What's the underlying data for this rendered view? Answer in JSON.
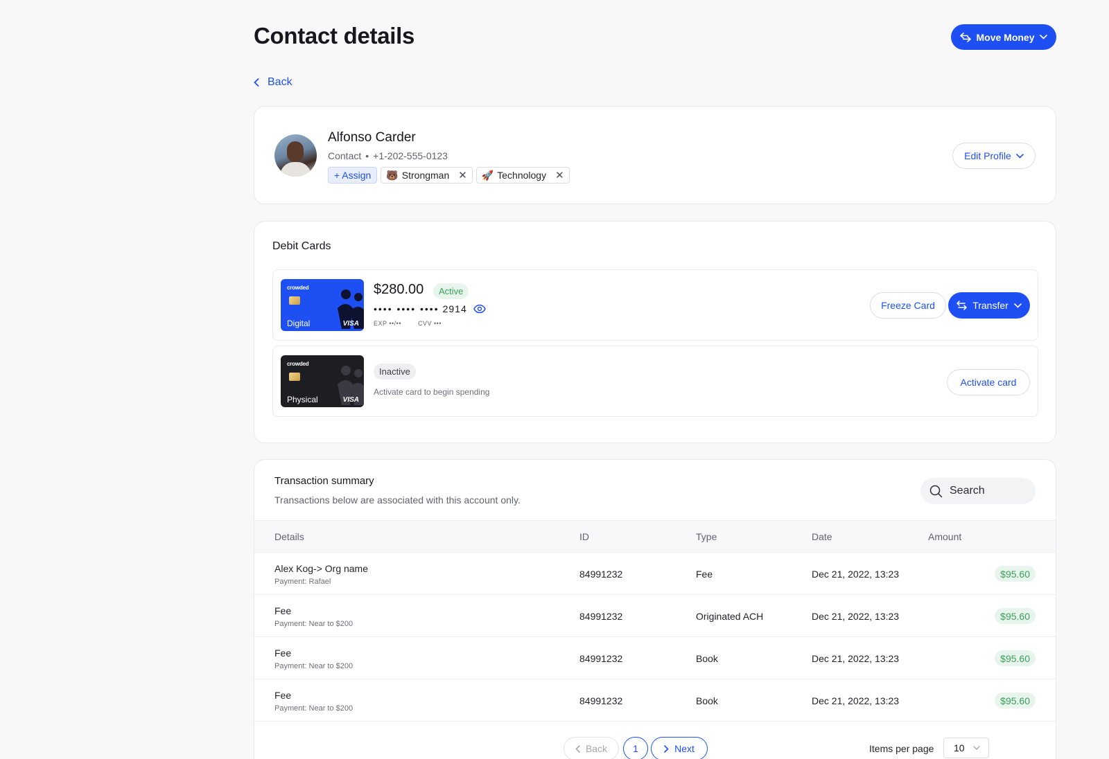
{
  "page": {
    "title": "Contact details",
    "move_money": "Move Money",
    "back": "Back"
  },
  "contact": {
    "name": "Alfonso Carder",
    "role": "Contact",
    "separator": "•",
    "phone": "+1-202-555-0123",
    "assign": "+ Assign",
    "tags": [
      {
        "emoji": "🐻",
        "label": "Strongman"
      },
      {
        "emoji": "🚀",
        "label": "Technology"
      }
    ],
    "edit_profile": "Edit Profile"
  },
  "debit_cards": {
    "title": "Debit Cards",
    "cards": [
      {
        "brand": "crowded",
        "kind": "Digital",
        "network": "VISA",
        "balance": "$280.00",
        "status": "Active",
        "number_masked": "•••• •••• ••••",
        "last4": "2914",
        "exp_label": "EXP",
        "exp_value": "••/••",
        "cvv_label": "CVV",
        "cvv_value": "•••",
        "freeze": "Freeze Card",
        "transfer": "Transfer",
        "color": "#1d4ff2"
      },
      {
        "brand": "crowded",
        "kind": "Physical",
        "network": "VISA",
        "status": "Inactive",
        "hint": "Activate card to begin spending",
        "activate": "Activate card",
        "color": "#1d1e22"
      }
    ]
  },
  "transactions": {
    "title": "Transaction summary",
    "subtitle": "Transactions below are associated with this account only.",
    "search_placeholder": "Search",
    "columns": [
      "Details",
      "ID",
      "Type",
      "Date",
      "Amount"
    ],
    "rows": [
      {
        "details": "Alex Kog-> Org name",
        "note": "Payment: Rafael",
        "id": "84991232",
        "type": "Fee",
        "date": "Dec 21, 2022, 13:23",
        "amount": "$95.60"
      },
      {
        "details": "Fee",
        "note": "Payment: Near to $200",
        "id": "84991232",
        "type": "Originated ACH",
        "date": "Dec 21, 2022, 13:23",
        "amount": "$95.60"
      },
      {
        "details": "Fee",
        "note": "Payment: Near to $200",
        "id": "84991232",
        "type": "Book",
        "date": "Dec 21, 2022, 13:23",
        "amount": "$95.60"
      },
      {
        "details": "Fee",
        "note": "Payment: Near to $200",
        "id": "84991232",
        "type": "Book",
        "date": "Dec 21, 2022, 13:23",
        "amount": "$95.60"
      }
    ],
    "pagination": {
      "back": "Back",
      "page": "1",
      "next": "Next",
      "items_per_page_label": "Items per page",
      "items_per_page": "10"
    }
  },
  "colors": {
    "accent": "#1d4ff2",
    "success_bg": "#e8f5ec",
    "success_text": "#3a9d5a",
    "background": "#f8f8f9"
  }
}
